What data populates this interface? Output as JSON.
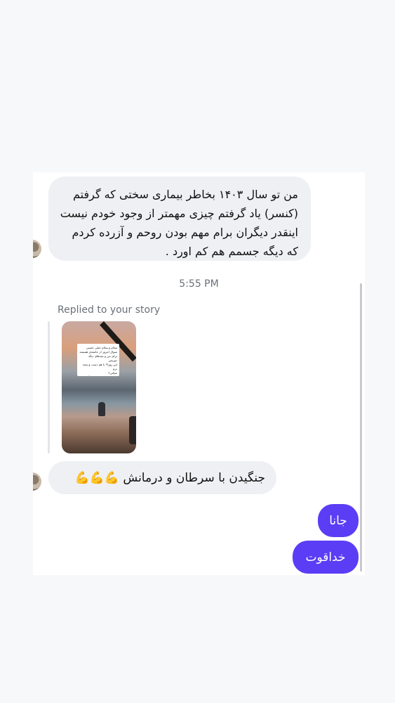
{
  "conversation": {
    "timestamp": "5:55 PM",
    "reply_label": "Replied to your story",
    "story_note_text": "سلام و سلام خیلی عجیبی\nسوال امروز از جامعه‌ی همیشه\nبرای من و بچه‌های دیگه دوریس\nاین روزا؟ با هم دست و پنجه نرم\nمیکنی؟\nقدم مثبتی که برای زندگیت برمیداری\nاین روزا؟ چیه؟",
    "messages": [
      {
        "direction": "incoming",
        "text": "من تو سال ۱۴۰۳ بخاطر بیماری سختی که گرفتم (کنسر) یاد گرفتم چیزی مهمتر از وجود خودم نیست اینقدر دیگران برام مهم بودن روحم و آزرده کردم که دیگه جسمم هم کم اورد ."
      },
      {
        "direction": "incoming",
        "text": "جنگیدن با سرطان و درمانش 💪💪💪"
      },
      {
        "direction": "outgoing",
        "text": "جانا"
      },
      {
        "direction": "outgoing",
        "text": "خداقوت"
      }
    ],
    "colors": {
      "outgoing_bubble": "#5b3df5",
      "incoming_bubble": "#eef0f3"
    }
  }
}
